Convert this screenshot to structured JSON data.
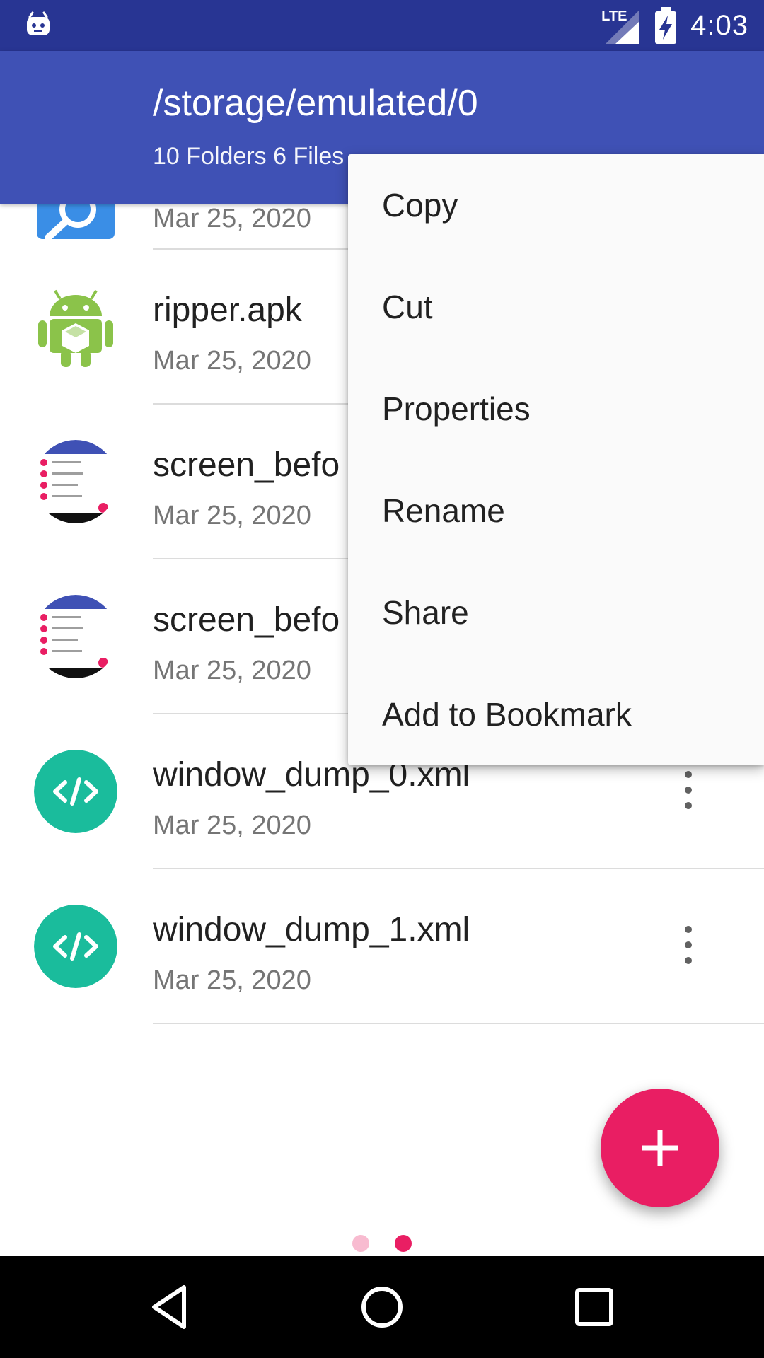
{
  "status": {
    "time": "4:03",
    "network": "LTE"
  },
  "appbar": {
    "path": "/storage/emulated/0",
    "summary": "10 Folders 6 Files"
  },
  "files": [
    {
      "name": "",
      "date": "Mar 25, 2020",
      "icon": "search-app-icon"
    },
    {
      "name": "ripper.apk",
      "date": "Mar 25, 2020",
      "icon": "android-apk-icon"
    },
    {
      "name": "screen_befo",
      "date": "Mar 25, 2020",
      "icon": "image-thumbnail-icon"
    },
    {
      "name": "screen_befo",
      "date": "Mar 25, 2020",
      "icon": "image-thumbnail-icon"
    },
    {
      "name": "window_dump_0.xml",
      "date": "Mar 25, 2020",
      "icon": "code-file-icon"
    },
    {
      "name": "window_dump_1.xml",
      "date": "Mar 25, 2020",
      "icon": "code-file-icon"
    }
  ],
  "menu": {
    "items": [
      "Copy",
      "Cut",
      "Properties",
      "Rename",
      "Share",
      "Add to Bookmark"
    ]
  },
  "colors": {
    "statusbar": "#283593",
    "appbar": "#3f51b5",
    "accent": "#e91e63",
    "code_icon": "#1abc9c"
  },
  "pager": {
    "count": 2,
    "active": 2
  }
}
